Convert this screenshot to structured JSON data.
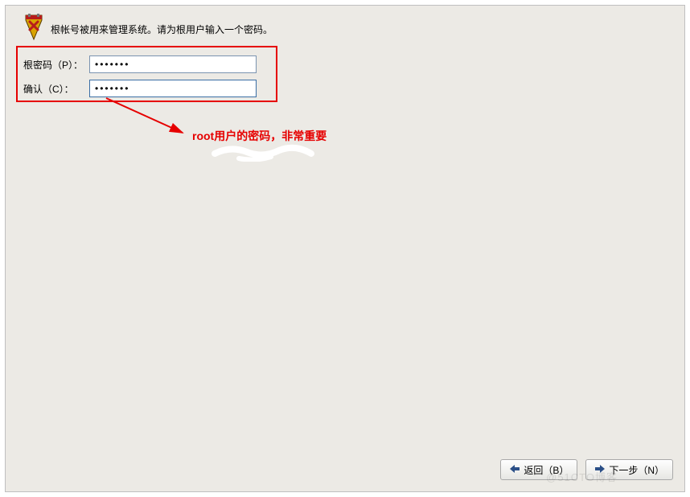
{
  "header": {
    "instruction": "根帐号被用来管理系统。请为根用户输入一个密码。"
  },
  "fields": {
    "password_label": "根密码（P）：",
    "password_value": "•••••••",
    "confirm_label": "确认（C）：",
    "confirm_value": "•••••••"
  },
  "annotation": {
    "text": "root用户的密码，非常重要"
  },
  "buttons": {
    "back_label": "返回（B）",
    "next_label": "下一步（N）"
  },
  "watermark": "@51CTO博客",
  "icons": {
    "shield": "shield-icon",
    "back_arrow": "arrow-left-icon",
    "next_arrow": "arrow-right-icon"
  }
}
